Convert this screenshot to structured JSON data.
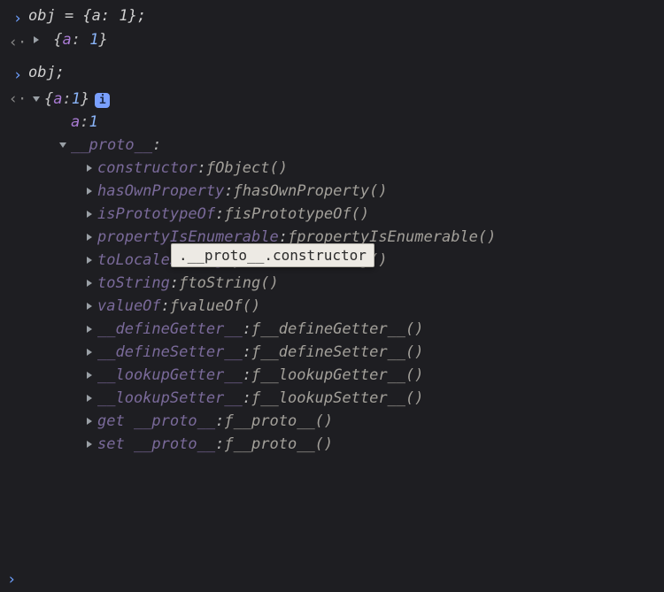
{
  "lines": {
    "input1_code": "obj = {a: 1};",
    "input2_code": "obj;"
  },
  "result1": {
    "brace_open": "{",
    "key": "a",
    "colon": ": ",
    "value": "1",
    "brace_close": "}"
  },
  "result2": {
    "brace_open": "{",
    "key": "a",
    "colon": ": ",
    "value": "1",
    "brace_close": "}",
    "info_label": "i"
  },
  "expanded": {
    "own_prop_key": "a",
    "own_prop_colon": ": ",
    "own_prop_val": "1",
    "proto_label": "__proto__",
    "proto_colon": ":"
  },
  "proto_props": [
    {
      "name": "constructor",
      "fn": "Object()"
    },
    {
      "name": "hasOwnProperty",
      "fn": "hasOwnProperty()"
    },
    {
      "name": "isPrototypeOf",
      "fn": "isPrototypeOf()"
    },
    {
      "name": "propertyIsEnumerable",
      "fn": "propertyIsEnumerable()"
    },
    {
      "name": "toLocaleString",
      "fn": "toLocaleString()"
    },
    {
      "name": "toString",
      "fn": "toString()"
    },
    {
      "name": "valueOf",
      "fn": "valueOf()"
    },
    {
      "name": "__defineGetter__",
      "fn": "__defineGetter__()"
    },
    {
      "name": "__defineSetter__",
      "fn": "__defineSetter__()"
    },
    {
      "name": "__lookupGetter__",
      "fn": "__lookupGetter__()"
    },
    {
      "name": "__lookupSetter__",
      "fn": "__lookupSetter__()"
    },
    {
      "name": "get __proto__",
      "fn": "__proto__()"
    },
    {
      "name": "set __proto__",
      "fn": "__proto__()"
    }
  ],
  "fn_glyph": "ƒ",
  "tooltip_text": ".__proto__.constructor",
  "prompt_glyph_in": "›",
  "prompt_glyph_out": "‹·",
  "prompt_next": "›"
}
